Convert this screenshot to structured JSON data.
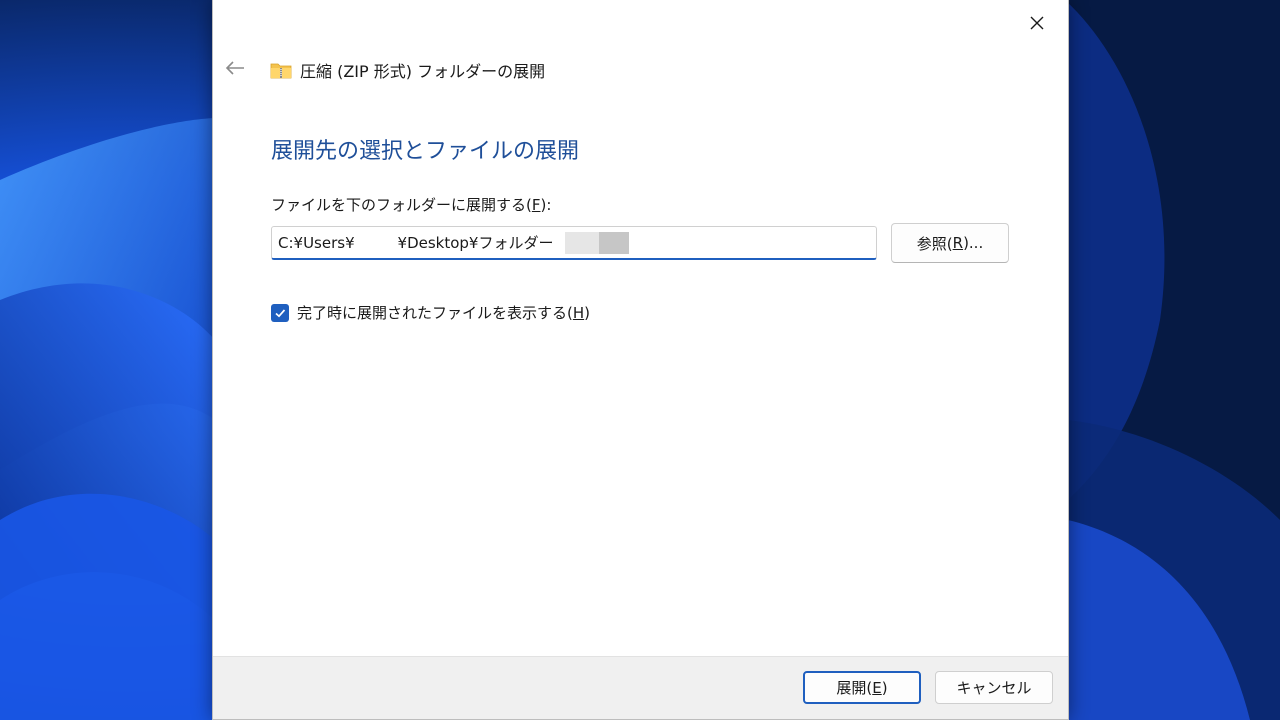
{
  "window": {
    "title": "圧縮 (ZIP 形式) フォルダーの展開",
    "close_icon": "close-icon",
    "back_icon": "arrow-left-icon",
    "folder_icon": "zip-folder-icon"
  },
  "main": {
    "heading": "展開先の選択とファイルの展開",
    "path_label_prefix": "ファイルを下のフォルダーに展開する(",
    "path_label_key": "F",
    "path_label_suffix": "):",
    "path_value": "C:¥Users¥         ¥Desktop¥フォルダー",
    "browse_prefix": "参照(",
    "browse_key": "R",
    "browse_suffix": ")...",
    "show_files_prefix": "完了時に展開されたファイルを表示する(",
    "show_files_key": "H",
    "show_files_suffix": ")",
    "show_files_checked": true
  },
  "footer": {
    "extract_prefix": "展開(",
    "extract_key": "E",
    "extract_suffix": ")",
    "cancel_label": "キャンセル"
  },
  "colors": {
    "accent": "#1f5fbf",
    "heading": "#1f4f99",
    "footer_bg": "#f0f0f0"
  }
}
